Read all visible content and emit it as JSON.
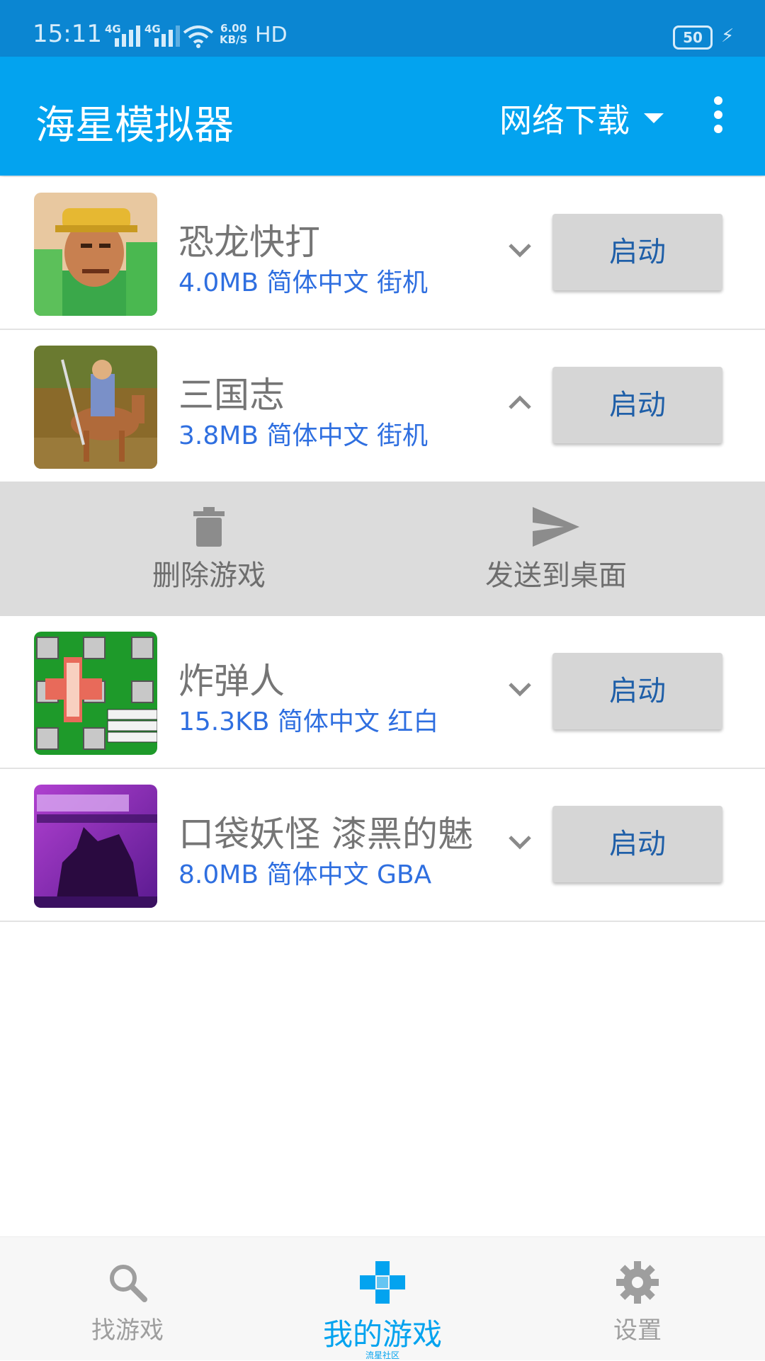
{
  "status_bar": {
    "time": "15:11",
    "net1": "4G",
    "net2": "4G",
    "speed_value": "6.00",
    "speed_unit": "KB/S",
    "hd": "HD",
    "battery": "50"
  },
  "app_bar": {
    "title": "海星模拟器",
    "download_label": "网络下载"
  },
  "games": [
    {
      "title": "恐龙快打",
      "size": "4.0MB",
      "lang": "简体中文",
      "platform": "街机",
      "launch": "启动",
      "expanded": false
    },
    {
      "title": "三国志",
      "size": "3.8MB",
      "lang": "简体中文",
      "platform": "街机",
      "launch": "启动",
      "expanded": true
    },
    {
      "title": "炸弹人",
      "size": "15.3KB",
      "lang": "简体中文",
      "platform": "红白",
      "launch": "启动",
      "expanded": false
    },
    {
      "title": "口袋妖怪 漆黑的魅",
      "size": "8.0MB",
      "lang": "简体中文",
      "platform": "GBA",
      "launch": "启动",
      "expanded": false
    }
  ],
  "actions": {
    "delete": "删除游戏",
    "send_desktop": "发送到桌面"
  },
  "bottom_nav": {
    "find": "找游戏",
    "mine": "我的游戏",
    "settings": "设置",
    "footer": "流星社区"
  },
  "colors": {
    "status_bar": "#0b86d2",
    "app_bar": "#03a3ef",
    "meta_text": "#2f6fe0",
    "button_bg": "#d6d6d6",
    "button_text": "#1f5fa8"
  }
}
